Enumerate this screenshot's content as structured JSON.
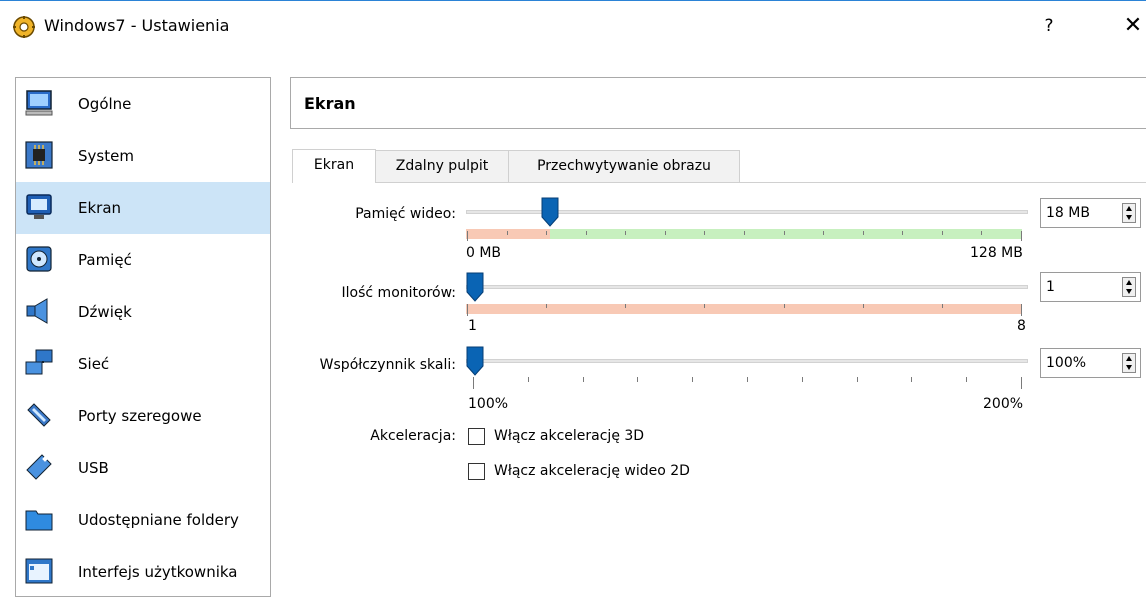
{
  "window": {
    "title": "Windows7 - Ustawienia",
    "help_label": "?",
    "close_label": "✕"
  },
  "sidebar": {
    "items": [
      {
        "label": "Ogólne",
        "icon": "monitor-icon"
      },
      {
        "label": "System",
        "icon": "chip-icon"
      },
      {
        "label": "Ekran",
        "icon": "display-icon",
        "selected": true
      },
      {
        "label": "Pamięć",
        "icon": "storage-icon"
      },
      {
        "label": "Dźwięk",
        "icon": "speaker-icon"
      },
      {
        "label": "Sieć",
        "icon": "network-icon"
      },
      {
        "label": "Porty szeregowe",
        "icon": "serial-port-icon"
      },
      {
        "label": "USB",
        "icon": "usb-icon"
      },
      {
        "label": "Udostępniane foldery",
        "icon": "folder-icon"
      },
      {
        "label": "Interfejs użytkownika",
        "icon": "ui-window-icon"
      }
    ]
  },
  "header": {
    "title": "Ekran"
  },
  "tabs": [
    {
      "label": "Ekran",
      "active": true
    },
    {
      "label": "Zdalny pulpit"
    },
    {
      "label": "Przechwytywanie obrazu"
    }
  ],
  "video_memory": {
    "label": "Pamięć wideo:",
    "min_label": "0 MB",
    "max_label": "128 MB",
    "value_display": "18 MB",
    "value": 18,
    "min": 0,
    "max": 128
  },
  "monitors": {
    "label": "Ilość monitorów:",
    "min_label": "1",
    "max_label": "8",
    "value_display": "1",
    "value": 1,
    "min": 1,
    "max": 8
  },
  "scale_factor": {
    "label": "Współczynnik skali:",
    "min_label": "100%",
    "max_label": "200%",
    "value_display": "100%",
    "value": 100,
    "min": 100,
    "max": 200
  },
  "acceleration": {
    "label": "Akceleracja:",
    "options": [
      {
        "label": "Włącz akcelerację 3D",
        "checked": false
      },
      {
        "label": "Włącz akcelerację wideo 2D",
        "checked": false
      }
    ]
  },
  "colors": {
    "accent": "#0a64b4",
    "selected_bg": "#cce4f7",
    "scale_red": "#f8c9b5",
    "scale_green": "#c7f0bf"
  }
}
